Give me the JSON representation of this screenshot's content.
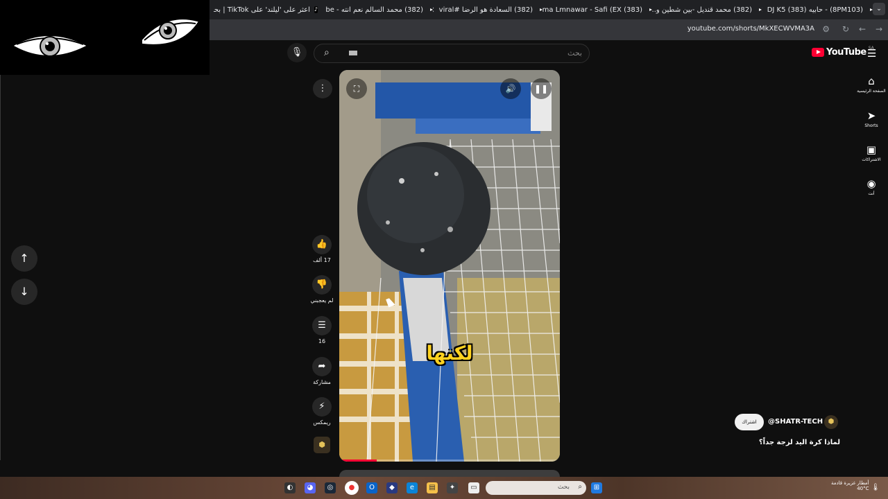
{
  "browser": {
    "tabs": [
      {
        "label": "(8PM103) - حابيه DJ K5 (383)",
        "favicon": "youtube"
      },
      {
        "label": "(382) محمد قنديل -بين شطين و...",
        "favicon": "youtube"
      },
      {
        "label": "(383) Asma Lmnawar - Safi (EX",
        "favicon": "youtube"
      },
      {
        "label": "(382) السعادة هو الرضا #viral",
        "favicon": "youtube"
      },
      {
        "label": "(382) محمد السالم نعم انته - be",
        "favicon": "youtube"
      },
      {
        "label": "اعثر على 'ليلند' على TikTok | بحث",
        "favicon": "tiktok"
      }
    ],
    "url": "youtube.com/shorts/MkXECWVMA3A"
  },
  "masthead": {
    "search_placeholder": "بحث",
    "logo_text": "YouTube",
    "region": "SA"
  },
  "sidebar": {
    "items": [
      {
        "label": "الصفحة الرئيسية",
        "icon": "home-icon"
      },
      {
        "label": "Shorts",
        "icon": "shorts-icon"
      },
      {
        "label": "الاشتراكات",
        "icon": "subscriptions-icon"
      },
      {
        "label": "أنت",
        "icon": "account-icon"
      }
    ]
  },
  "short": {
    "caption": "لكنها",
    "progress": 0.17,
    "actions": {
      "like_count": "17 ألف",
      "dislike_label": "لم يعجبني",
      "comments_count": "16",
      "share_label": "مشاركة",
      "remix_label": "ريمكس"
    },
    "channel": {
      "name": "@SHATR-TECH",
      "subscribe_label": "اشتراك"
    },
    "title": "لماذا كرة اليد لزجة جداً؟"
  },
  "taskbar": {
    "search_placeholder": "بحث",
    "weather_text": "أمطار غزيرة قادمة",
    "temperature": "40°C"
  },
  "colors": {
    "accent": "#ff0033",
    "background": "#0f0f0f",
    "caption": "#ffd21f"
  }
}
